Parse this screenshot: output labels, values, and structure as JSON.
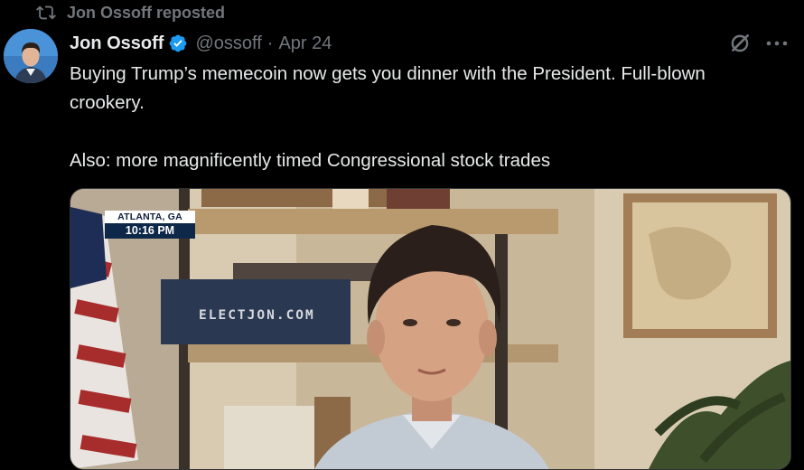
{
  "repost": {
    "label": "Jon Ossoff reposted",
    "icon": "repost-icon"
  },
  "author": {
    "name": "Jon Ossoff",
    "handle": "@ossoff",
    "separator": "·",
    "date": "Apr 24",
    "verified": true,
    "avatar": "author-avatar"
  },
  "actions": {
    "grok_icon": "grok-icon",
    "more_icon": "more-icon"
  },
  "tweet": {
    "paragraphs": [
      "Buying Trump’s memecoin now gets you dinner with the President. Full-blown crookery.",
      "Also: more magnificently timed Congressional stock trades"
    ]
  },
  "media": {
    "location": "ATLANTA, GA",
    "time": "10:16 PM",
    "sign": "ELECTJON.COM"
  },
  "colors": {
    "background": "#000000",
    "text": "#e7e9ea",
    "muted": "#71767b",
    "verified": "#1d9bf0",
    "badge_navy": "#0e2849"
  }
}
